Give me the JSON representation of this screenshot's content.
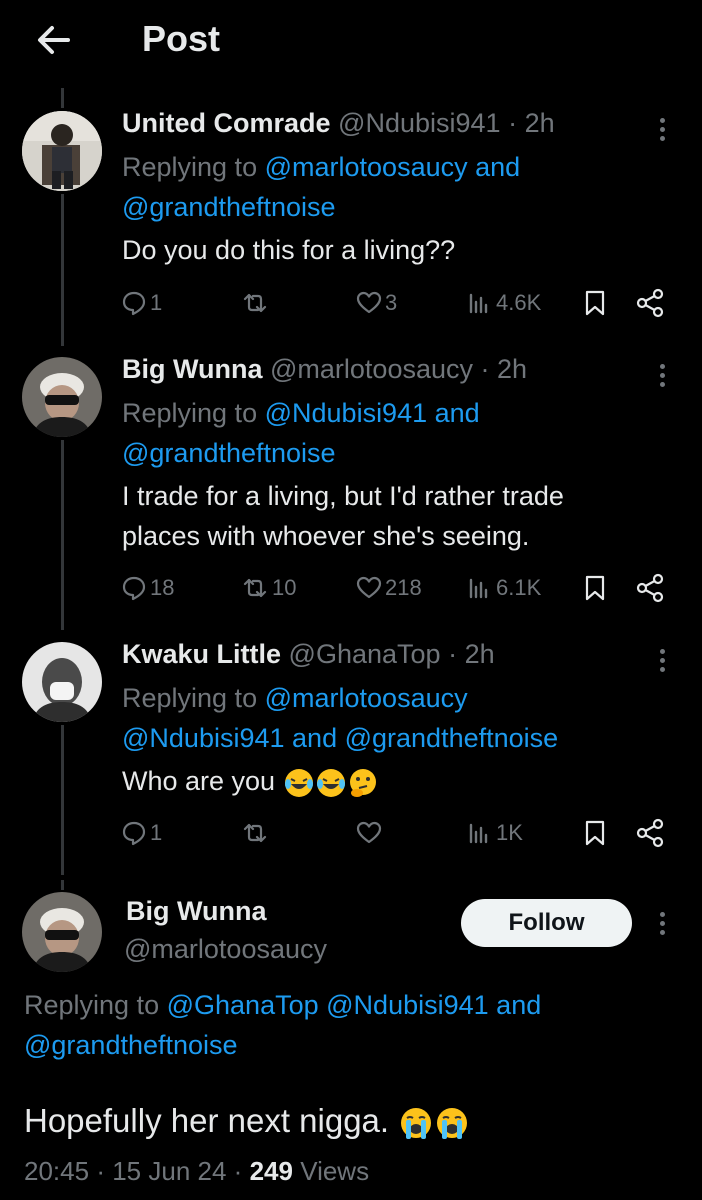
{
  "header": {
    "title": "Post",
    "back_icon": "arrow-left-icon"
  },
  "tweets": [
    {
      "display_name": "United Comrade",
      "handle": "@Ndubisi941",
      "sep": "·",
      "time": "2h",
      "replying_label": "Replying to",
      "mention_1": "@marlotoosaucy",
      "and_1": "and",
      "mention_2": "@grandtheftnoise",
      "text_line_1": "Do you do this for a living??",
      "reply_count": "1",
      "repost_count": "",
      "like_count": "3",
      "view_count": "4.6K"
    },
    {
      "display_name": "Big Wunna",
      "handle": "@marlotoosaucy",
      "sep": "·",
      "time": "2h",
      "replying_label": "Replying to",
      "mention_1": "@Ndubisi941",
      "and_1": "and",
      "mention_2": "@grandtheftnoise",
      "text_line_1": "I trade for a living, but I'd rather trade",
      "text_line_2": "places with whoever she's seeing.",
      "reply_count": "18",
      "repost_count": "10",
      "like_count": "218",
      "view_count": "6.1K"
    },
    {
      "display_name": "Kwaku Little",
      "handle": "@GhanaTop",
      "sep": "·",
      "time": "2h",
      "replying_label": "Replying to",
      "mention_1": "@marlotoosaucy",
      "mention_2": "@Ndubisi941",
      "and_1": "and",
      "mention_3": "@grandtheftnoise",
      "text_line_1": "Who are you",
      "reply_count": "1",
      "repost_count": "",
      "like_count": "",
      "view_count": "1K"
    }
  ],
  "main": {
    "display_name": "Big Wunna",
    "handle": "@marlotoosaucy",
    "follow_label": "Follow",
    "replying_label": "Replying to",
    "mention_1": "@GhanaTop",
    "mention_2": "@Ndubisi941",
    "and_1": "and",
    "mention_3": "@grandtheftnoise",
    "text": "Hopefully her next nigga.",
    "time": "20:45",
    "sep": "·",
    "date": "15 Jun 24",
    "views_count": "249",
    "views_label": "Views"
  },
  "colors": {
    "background": "#000000",
    "text": "#e7e9ea",
    "muted": "#71767b",
    "link": "#1d9bf0",
    "follow_bg": "#eff3f4"
  }
}
